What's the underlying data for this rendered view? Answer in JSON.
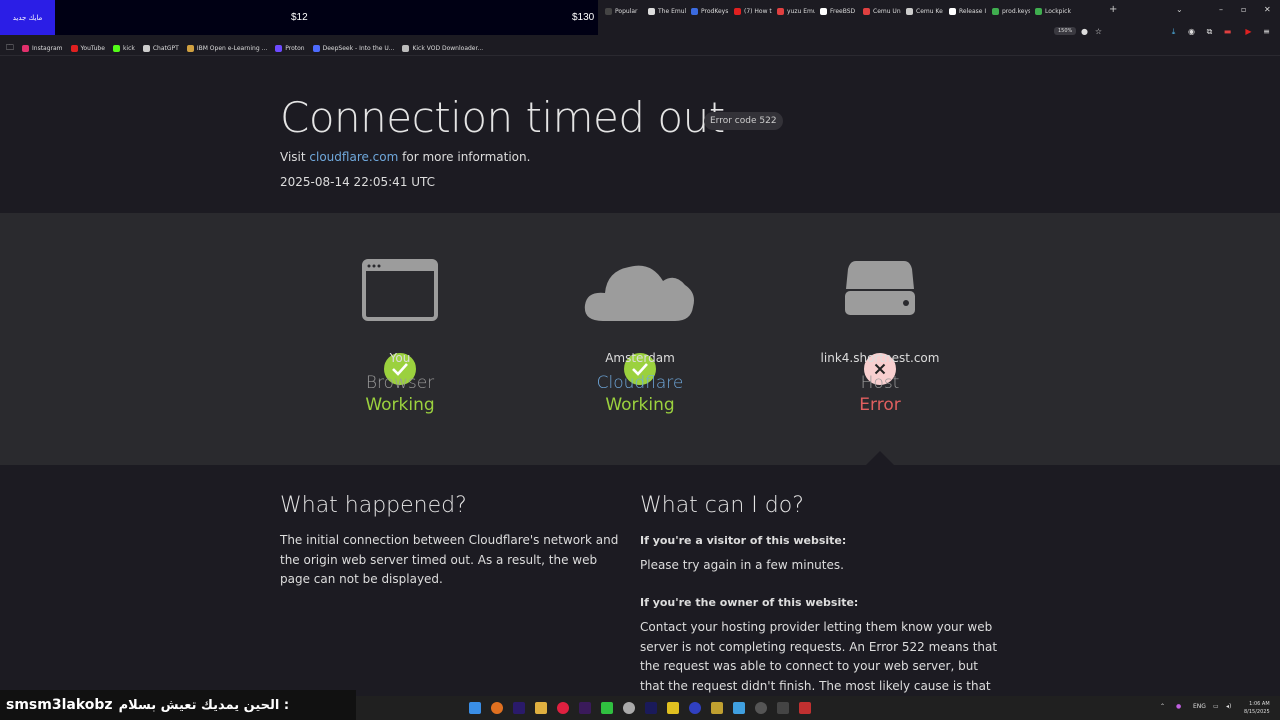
{
  "stream_overlay": {
    "badge": "مايك جديد",
    "price_a": "$12",
    "price_b": "$130",
    "streamer_name": "smsm3lakobz",
    "streamer_message": "الحين يمديك تعيش بسلام :"
  },
  "browser": {
    "tabs": [
      {
        "label": "Popular",
        "color": "#444"
      },
      {
        "label": "The Emul",
        "color": "#ddd"
      },
      {
        "label": "ProdKeys",
        "color": "#3b6be0"
      },
      {
        "label": "(7) How t",
        "color": "#e02020"
      },
      {
        "label": "yuzu Emu",
        "color": "#e04040"
      },
      {
        "label": "FreeBSD",
        "color": "#ffffff"
      },
      {
        "label": "Cemu Un",
        "color": "#e04040"
      },
      {
        "label": "Cemu Ke",
        "color": "#cccccc"
      },
      {
        "label": "Release I",
        "color": "#ffffff"
      },
      {
        "label": "prod.keys",
        "color": "#3fae4f"
      },
      {
        "label": "Lockpick",
        "color": "#3fae4f"
      }
    ],
    "new_tab": "+",
    "zoom": "150%",
    "bookmarks": [
      {
        "label": "Instagram",
        "color": "#e1306c"
      },
      {
        "label": "YouTube",
        "color": "#e02020"
      },
      {
        "label": "kick",
        "color": "#53fc18"
      },
      {
        "label": "ChatGPT",
        "color": "#cccccc"
      },
      {
        "label": "IBM Open e-Learning ...",
        "color": "#d0a040"
      },
      {
        "label": "Proton",
        "color": "#6d4aff"
      },
      {
        "label": "DeepSeek - Into the U...",
        "color": "#4d6bfe"
      },
      {
        "label": "Kick VOD Downloader...",
        "color": "#bbbbbb"
      }
    ]
  },
  "page": {
    "title": "Connection timed out",
    "error_code": "Error code 522",
    "visit_prefix": "Visit",
    "visit_link": "cloudflare.com",
    "visit_suffix": "for more information.",
    "timestamp": "2025-08-14 22:05:41 UTC",
    "nodes": [
      {
        "location": "You",
        "kind": "Browser",
        "status": "Working"
      },
      {
        "location": "Amsterdam",
        "kind": "Cloudflare",
        "status": "Working"
      },
      {
        "location": "link4.shortnest.com",
        "kind": "Host",
        "status": "Error"
      }
    ],
    "what_happened": {
      "heading": "What happened?",
      "body": "The initial connection between Cloudflare's network and the origin web server timed out. As a result, the web page can not be displayed."
    },
    "what_can_i_do": {
      "heading": "What can I do?",
      "visitor_heading": "If you're a visitor of this website:",
      "visitor_body": "Please try again in a few minutes.",
      "owner_heading": "If you're the owner of this website:",
      "owner_body": "Contact your hosting provider letting them know your web server is not completing requests. An Error 522 means that the request was able to connect to your web server, but that the request didn't finish. The most likely cause is that something on your server is"
    }
  },
  "taskbar": {
    "language": "ENG",
    "time": "1:06 AM",
    "date": "8/15/2025"
  },
  "colors": {
    "ok": "#9bd13e",
    "error": "#e05f5f",
    "link": "#6fa8dc"
  }
}
